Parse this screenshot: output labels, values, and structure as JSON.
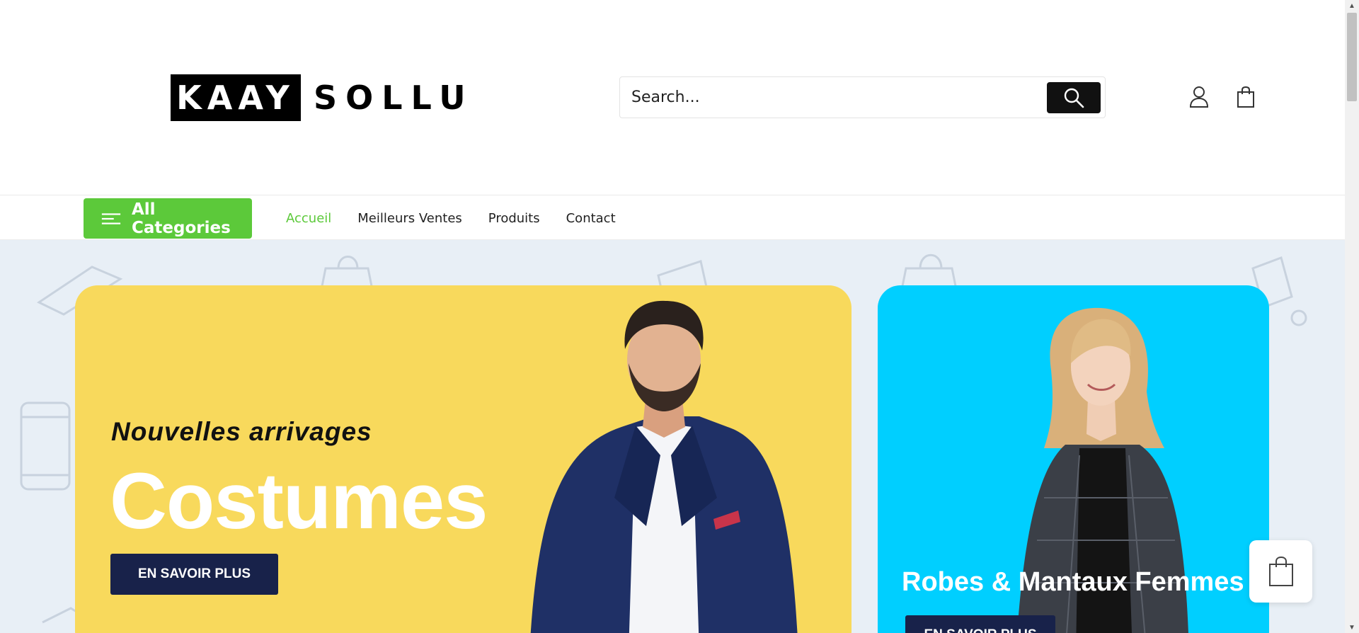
{
  "logo": {
    "box_text": "KAAY",
    "word_text": "SOLLU"
  },
  "search": {
    "placeholder": "Search...",
    "button_icon": "search-icon"
  },
  "header_icons": [
    "user-icon",
    "shopping-bag-icon"
  ],
  "nav": {
    "categories_label": "All Categories",
    "links": [
      {
        "label": "Accueil",
        "active": true
      },
      {
        "label": "Meilleurs Ventes",
        "active": false
      },
      {
        "label": "Produits",
        "active": false
      },
      {
        "label": "Contact",
        "active": false
      }
    ]
  },
  "banner_main": {
    "kicker": "Nouvelles arrivages",
    "title": "Costumes",
    "button": "EN SAVOIR PLUS",
    "background": "#f8d95c"
  },
  "banner_side": {
    "title": "Robes & Mantaux Femmes",
    "button": "EN SAVOIR PLUS",
    "background": "#00cfff"
  },
  "floating_cart": {
    "icon": "shopping-bag-icon"
  },
  "colors": {
    "accent": "#5cc93a",
    "button_dark": "#18224a",
    "hero_bg": "#e8eff6"
  }
}
